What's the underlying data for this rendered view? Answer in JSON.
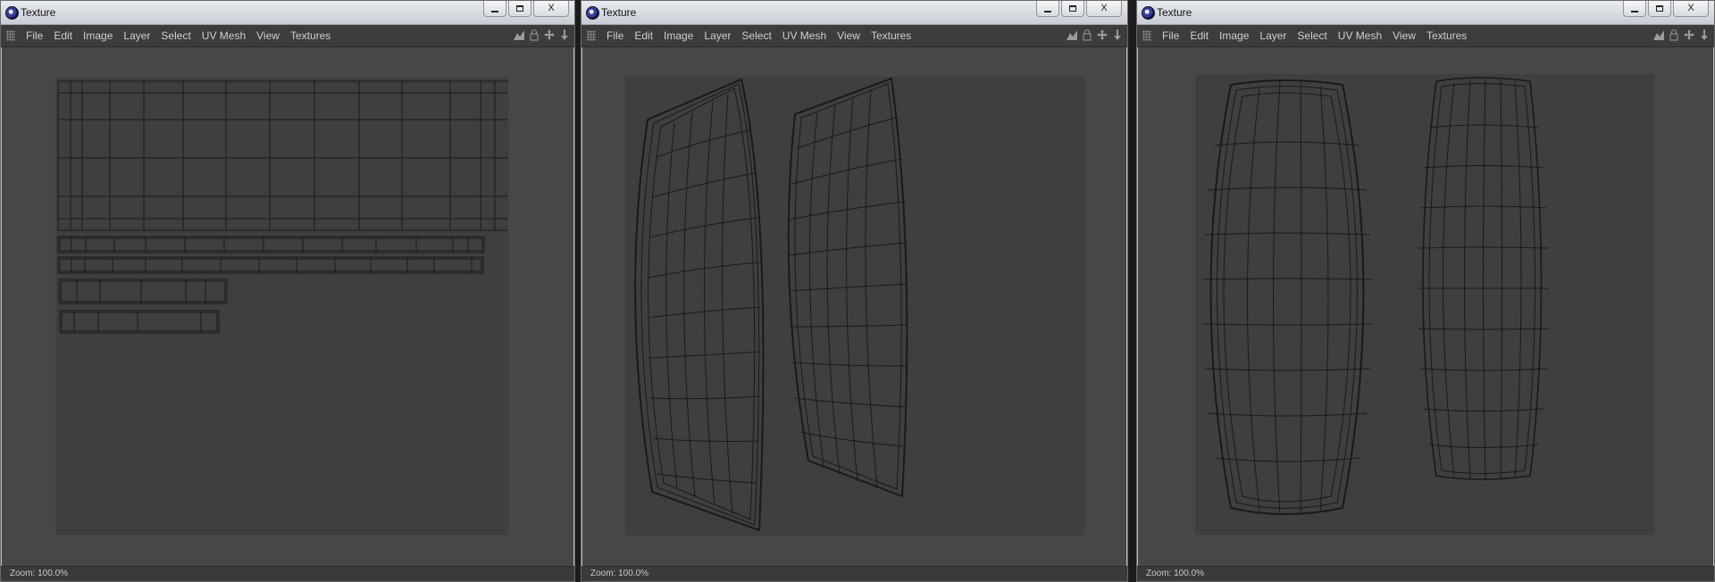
{
  "windows": [
    {
      "title": "Texture",
      "menu": [
        "File",
        "Edit",
        "Image",
        "Layer",
        "Select",
        "UV Mesh",
        "View",
        "Textures"
      ],
      "status": "Zoom: 100.0%",
      "uv_layout": "strips"
    },
    {
      "title": "Texture",
      "menu": [
        "File",
        "Edit",
        "Image",
        "Layer",
        "Select",
        "UV Mesh",
        "View",
        "Textures"
      ],
      "status": "Zoom: 100.0%",
      "uv_layout": "curved-shells-skewed"
    },
    {
      "title": "Texture",
      "menu": [
        "File",
        "Edit",
        "Image",
        "Layer",
        "Select",
        "UV Mesh",
        "View",
        "Textures"
      ],
      "status": "Zoom: 100.0%",
      "uv_layout": "barrel-shells"
    }
  ],
  "window_controls": {
    "minimize": "minimize-icon",
    "maximize": "maximize-icon",
    "close": "X"
  },
  "toolbar_icons": [
    "histogram-icon",
    "lock-icon",
    "move-icon",
    "download-icon"
  ],
  "colors": {
    "viewport": "#474747",
    "canvas": "#3f3f3f",
    "wire": "#1a1a1a"
  }
}
